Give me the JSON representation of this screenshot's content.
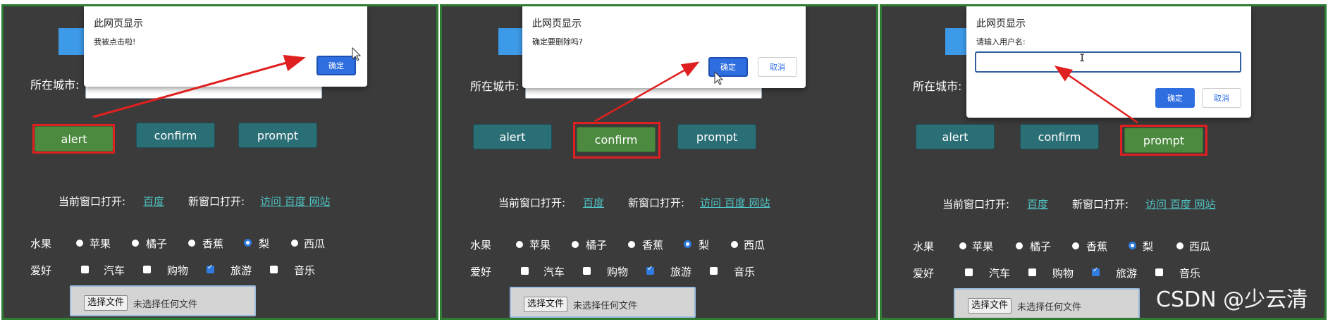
{
  "panels": [
    {
      "city_label": "所在城市:",
      "buttons": [
        "alert",
        "confirm",
        "prompt"
      ],
      "active_button": "alert",
      "links": {
        "current_label": "当前窗口打开:",
        "current_link": "百度",
        "new_label": "新窗口打开:",
        "new_link": "访问 百度 网站"
      },
      "fruit": {
        "label": "水果",
        "options": [
          "苹果",
          "橘子",
          "香蕉",
          "梨",
          "西瓜"
        ],
        "selected": "梨"
      },
      "hobby": {
        "label": "爱好",
        "options": [
          "汽车",
          "购物",
          "旅游",
          "音乐"
        ],
        "checked": [
          "旅游"
        ]
      },
      "file": {
        "button": "选择文件",
        "status": "未选择任何文件"
      },
      "dialog": {
        "title": "此网页显示",
        "message": "我被点击啦!",
        "ok": "确定"
      }
    },
    {
      "city_label": "所在城市:",
      "buttons": [
        "alert",
        "confirm",
        "prompt"
      ],
      "active_button": "confirm",
      "links": {
        "current_label": "当前窗口打开:",
        "current_link": "百度",
        "new_label": "新窗口打开:",
        "new_link": "访问 百度 网站"
      },
      "fruit": {
        "label": "水果",
        "options": [
          "苹果",
          "橘子",
          "香蕉",
          "梨",
          "西瓜"
        ],
        "selected": "梨"
      },
      "hobby": {
        "label": "爱好",
        "options": [
          "汽车",
          "购物",
          "旅游",
          "音乐"
        ],
        "checked": [
          "旅游"
        ]
      },
      "file": {
        "button": "选择文件",
        "status": "未选择任何文件"
      },
      "dialog": {
        "title": "此网页显示",
        "message": "确定要删除吗?",
        "ok": "确定",
        "cancel": "取消"
      }
    },
    {
      "city_label": "所在城市:",
      "buttons": [
        "alert",
        "confirm",
        "prompt"
      ],
      "active_button": "prompt",
      "links": {
        "current_label": "当前窗口打开:",
        "current_link": "百度",
        "new_label": "新窗口打开:",
        "new_link": "访问 百度 网站"
      },
      "fruit": {
        "label": "水果",
        "options": [
          "苹果",
          "橘子",
          "香蕉",
          "梨",
          "西瓜"
        ],
        "selected": "梨"
      },
      "hobby": {
        "label": "爱好",
        "options": [
          "汽车",
          "购物",
          "旅游",
          "音乐"
        ],
        "checked": [
          "旅游"
        ]
      },
      "file": {
        "button": "选择文件",
        "status": "未选择任何文件"
      },
      "dialog": {
        "title": "此网页显示",
        "message": "请输入用户名:",
        "input_value": "",
        "ok": "确定",
        "cancel": "取消"
      }
    }
  ],
  "colors": {
    "panel_bg": "#3b3b3b",
    "panel_border": "#2e7d32",
    "button": "#2b6f76",
    "button_active": "#4b8a3f",
    "highlight": "#e02020",
    "link": "#4fc3c3",
    "dialog_ok": "#2f6ee0"
  },
  "watermark": "CSDN @少云清"
}
